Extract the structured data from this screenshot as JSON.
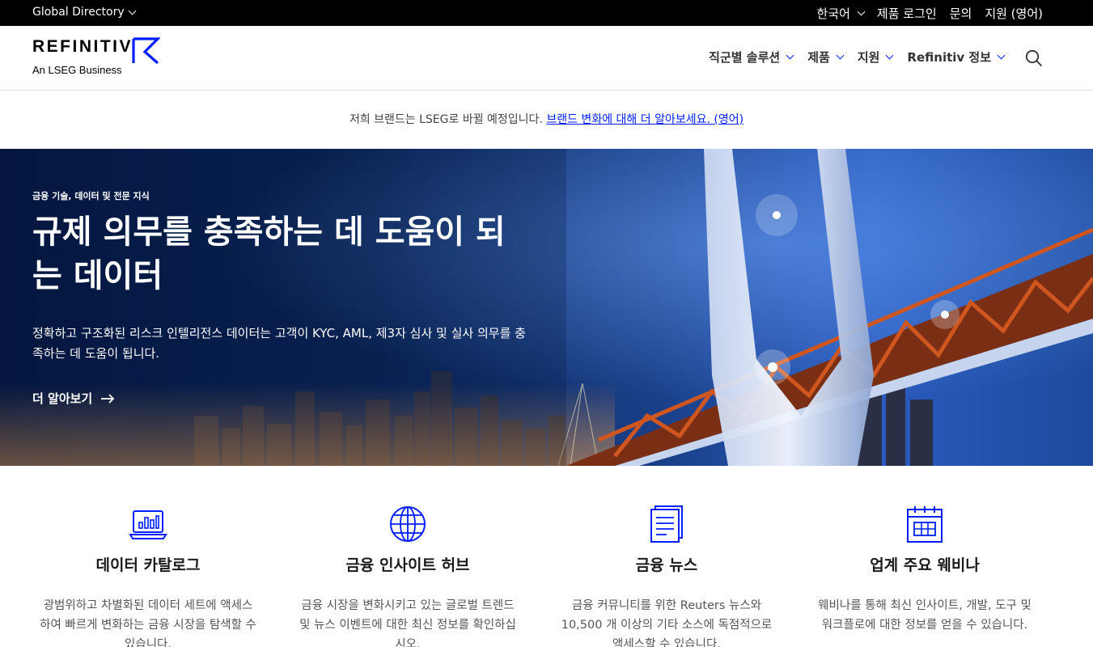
{
  "topbar": {
    "global_directory": "Global Directory",
    "links": [
      "한국어",
      "제품 로그인",
      "문의",
      "지원 (영어)"
    ]
  },
  "header": {
    "logo_text": "REFINITIV",
    "logo_sub": "An LSEG Business",
    "nav": [
      "직군별 솔루션",
      "제품",
      "지원",
      "Refinitiv 정보"
    ]
  },
  "notice": {
    "text": "저희 브랜드는 LSEG로 바뀔 예정입니다. ",
    "link": "브랜드 변화에 대해 더 알아보세요. (영어)"
  },
  "hero": {
    "eyebrow": "금융 기술, 데이터 및 전문 지식",
    "title": "규제 의무를 충족하는 데      도움이 되는 데이터",
    "description": "정확하고 구조화된 리스크 인텔리전스 데이터는 고객이 KYC, AML, 제3자 심사 및 실사 의무를 충족하는 데 도움이 됩니다.",
    "cta": "더 알아보기"
  },
  "features": [
    {
      "icon": "laptop-chart-icon",
      "title": "데이터 카탈로그",
      "text": "광범위하고 차별화된 데이터 세트에 액세스하여 빠르게 변화하는 금융 시장을 탐색할 수 있습니다."
    },
    {
      "icon": "globe-icon",
      "title": "금융 인사이트 허브",
      "text": "금융 시장을 변화시키고 있는 글로벌 트렌드 및 뉴스 이벤트에 대한 최신 정보를 확인하십시오."
    },
    {
      "icon": "news-document-icon",
      "title": "금융 뉴스",
      "text": "금융 커뮤니티를 위한 Reuters 뉴스와 10,500 개 이상의 기타 소스에 독점적으로 액세스할 수 있습니다."
    },
    {
      "icon": "calendar-icon",
      "title": "업계 주요 웨비나",
      "text": "웨비나를 통해 최신 인사이트, 개발, 도구 및 워크플로에 대한 정보를 얻을 수 있습니다."
    }
  ],
  "colors": {
    "accent": "#001eff",
    "topbar": "#000000"
  }
}
